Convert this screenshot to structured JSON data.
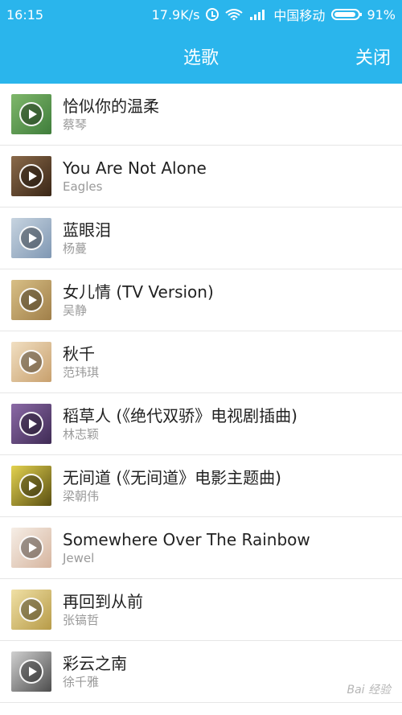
{
  "status_bar": {
    "time": "16:15",
    "speed": "17.9K/s",
    "carrier": "中国移动",
    "battery": "91%",
    "icons": [
      "alarm-icon",
      "wifi-icon",
      "signal-icon",
      "battery-icon"
    ]
  },
  "header": {
    "title": "选歌",
    "close_label": "关闭",
    "color": "#2ab5ec"
  },
  "songs": [
    {
      "title": "恰似你的温柔",
      "artist": "蔡琴",
      "art_color": "#6aa55a"
    },
    {
      "title": "You Are Not Alone",
      "artist": "Eagles",
      "art_color": "#6b4a2c"
    },
    {
      "title": "蓝眼泪",
      "artist": "杨蔓",
      "art_color": "#a7b7c7"
    },
    {
      "title": "女儿情 (TV Version)",
      "artist": "吴静",
      "art_color": "#bfa06a"
    },
    {
      "title": "秋千",
      "artist": "范玮琪",
      "art_color": "#e3c49a"
    },
    {
      "title": "稻草人 (《绝代双骄》电视剧插曲)",
      "artist": "林志颖",
      "art_color": "#6b4a86"
    },
    {
      "title": "无间道 (《无间道》电影主题曲)",
      "artist": "梁朝伟",
      "art_color": "#c9b32a"
    },
    {
      "title": "Somewhere Over The Rainbow",
      "artist": "Jewel",
      "art_color": "#e6d2c2"
    },
    {
      "title": "再回到从前",
      "artist": "张镐哲",
      "art_color": "#d6c17a"
    },
    {
      "title": "彩云之南",
      "artist": "徐千雅",
      "art_color": "#8b8b8b"
    }
  ],
  "watermark": "Bai 经验"
}
